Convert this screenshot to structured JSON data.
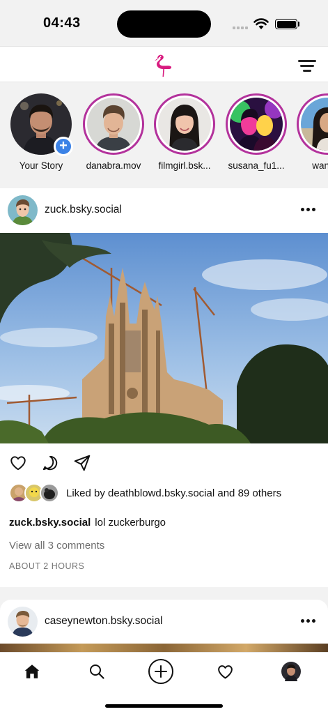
{
  "status_bar": {
    "time": "04:43"
  },
  "stories": [
    {
      "label": "Your Story",
      "own": true
    },
    {
      "label": "danabra.mov"
    },
    {
      "label": "filmgirl.bsk..."
    },
    {
      "label": "susana_fu1..."
    },
    {
      "label": "wang..."
    }
  ],
  "posts": [
    {
      "handle": "zuck.bsky.social",
      "liked_by_prefix": "Liked by ",
      "liked_by_user": "deathblowd.bsky.social",
      "liked_by_suffix": " and 89 others",
      "caption_author": "zuck.bsky.social",
      "caption_text": "lol zuckerburgo",
      "view_comments": "View all 3 comments",
      "timestamp": "ABOUT 2 HOURS"
    },
    {
      "handle": "caseynewton.bsky.social"
    }
  ],
  "icons": {
    "logo": "flamingo-logo-icon",
    "filter": "filter-icon",
    "like": "heart-icon",
    "comment": "comment-icon",
    "share": "send-icon",
    "home": "home-icon",
    "search": "search-icon",
    "compose": "plus-circle-icon",
    "activity": "heart-icon"
  },
  "colors": {
    "accent_ring": "#b3329c",
    "logo": "#d81b7f",
    "add_badge": "#3b82e6"
  }
}
